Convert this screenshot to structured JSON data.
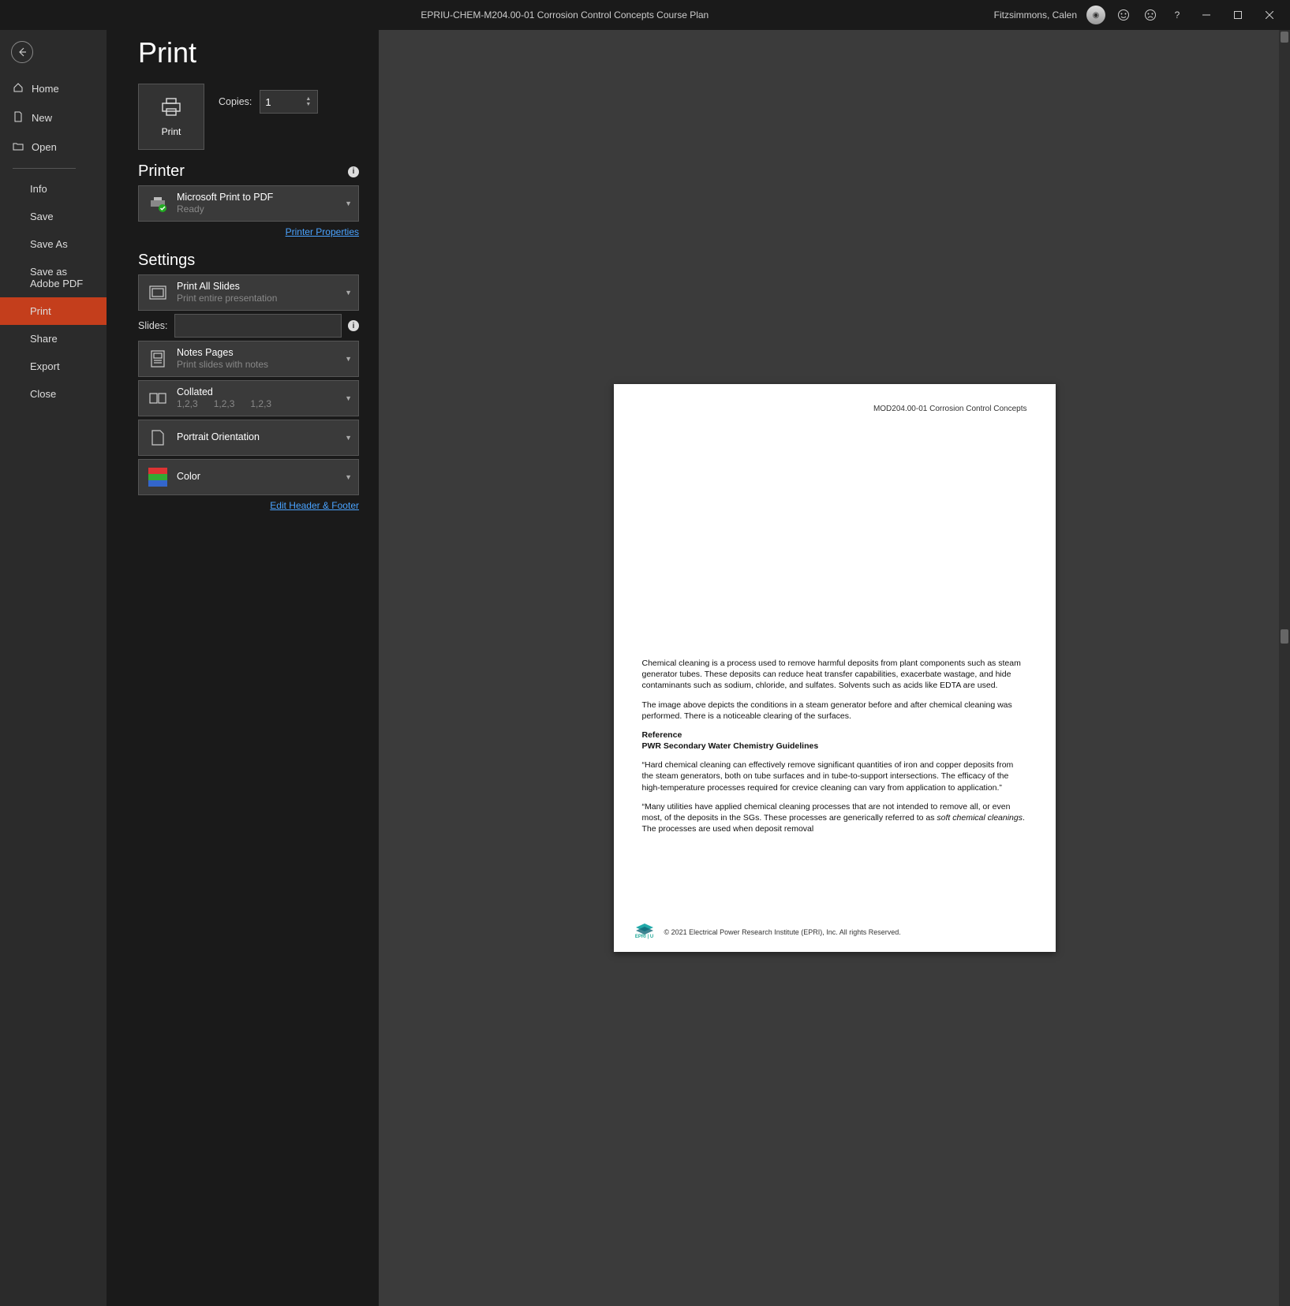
{
  "titlebar": {
    "doc_title": "EPRIU-CHEM-M204.00-01 Corrosion Control Concepts Course Plan",
    "user_name": "Fitzsimmons, Calen"
  },
  "sidebar": {
    "top": [
      {
        "label": "Home"
      },
      {
        "label": "New"
      },
      {
        "label": "Open"
      }
    ],
    "bottom": [
      {
        "label": "Info"
      },
      {
        "label": "Save"
      },
      {
        "label": "Save As"
      },
      {
        "label": "Save as Adobe PDF"
      },
      {
        "label": "Print",
        "active": true
      },
      {
        "label": "Share"
      },
      {
        "label": "Export"
      },
      {
        "label": "Close"
      }
    ]
  },
  "page_title": "Print",
  "print_button": "Print",
  "copies": {
    "label": "Copies:",
    "value": "1"
  },
  "printer_section": "Printer",
  "printer": {
    "name": "Microsoft Print to PDF",
    "status": "Ready"
  },
  "printer_props_link": "Printer Properties",
  "settings_section": "Settings",
  "setting_what": {
    "l1": "Print All Slides",
    "l2": "Print entire presentation"
  },
  "slides": {
    "label": "Slides:",
    "value": ""
  },
  "setting_layout": {
    "l1": "Notes Pages",
    "l2": "Print slides with notes"
  },
  "setting_collate": {
    "l1": "Collated",
    "l2": "1,2,3      1,2,3      1,2,3"
  },
  "setting_orient": {
    "l1": "Portrait Orientation"
  },
  "setting_color": {
    "l1": "Color"
  },
  "edit_hf_link": "Edit Header & Footer",
  "preview": {
    "header": "MOD204.00-01  Corrosion Control Concepts",
    "p1": "Chemical cleaning is a process used to remove harmful deposits from plant components such as steam generator tubes. These deposits can reduce heat transfer capabilities, exacerbate wastage, and hide contaminants such as sodium, chloride, and sulfates. Solvents such as acids like EDTA are used.",
    "p2": "The image above depicts the conditions in a steam generator before and after chemical cleaning was performed. There is a noticeable clearing of the surfaces.",
    "ref_title": "Reference",
    "ref_sub": "PWR Secondary Water Chemistry Guidelines",
    "q1": "“Hard chemical cleaning can effectively remove significant quantities of iron and copper deposits from the steam generators, both on tube surfaces and in tube-to-support intersections. The efficacy of the high-temperature processes required for crevice cleaning can vary from application to application.”",
    "q2a": "“Many utilities have applied chemical cleaning processes that are not intended to remove all, or even most, of the deposits in the SGs. These processes are generically referred to as ",
    "q2i": "soft chemical cleanings",
    "q2b": ". The processes are used when deposit removal",
    "copyright": "© 2021 Electrical Power Research Institute (EPRI), Inc. All rights Reserved.",
    "logo_text": "EPRI | U"
  }
}
